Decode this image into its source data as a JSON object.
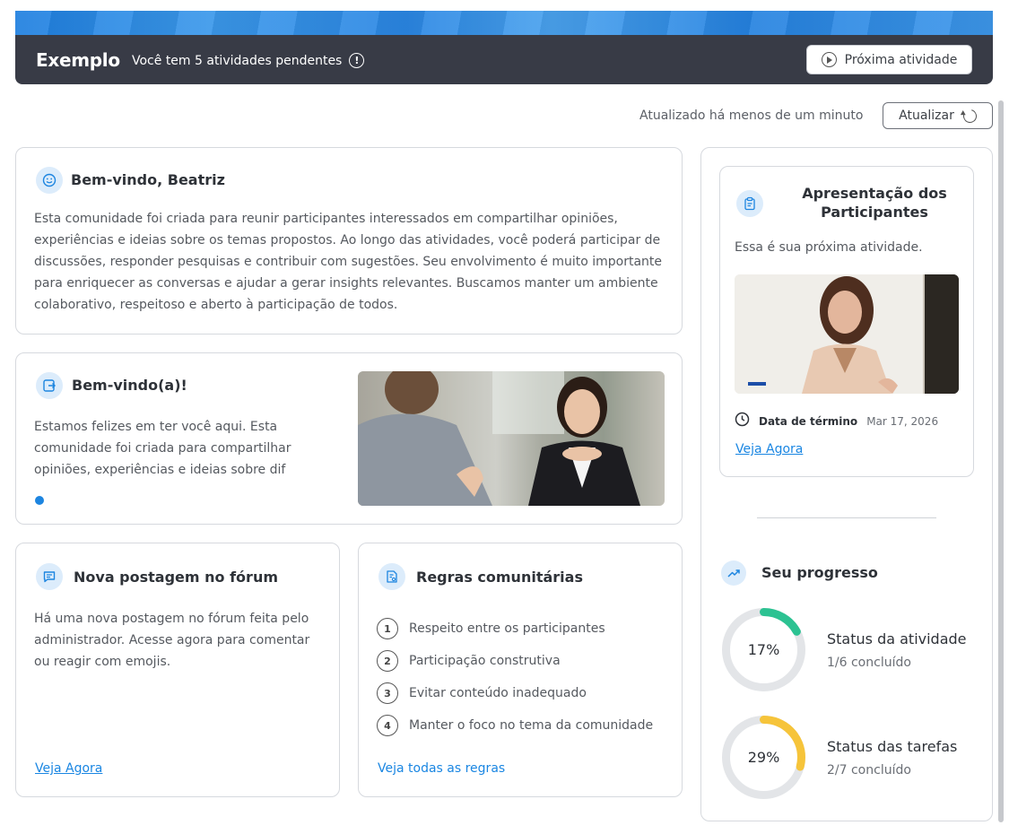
{
  "header": {
    "brand": "Exemplo",
    "pending_text": "Você tem 5 atividades pendentes",
    "next_button": "Próxima atividade"
  },
  "update": {
    "status": "Atualizado há menos de um minuto",
    "button": "Atualizar"
  },
  "welcome": {
    "title": "Bem-vindo, Beatriz",
    "text": "Esta comunidade foi criada para reunir participantes interessados em compartilhar opiniões, experiências e ideias sobre os temas propostos. Ao longo das atividades, você poderá participar de discussões, responder pesquisas e contribuir com sugestões. Seu envolvimento é muito importante para enriquecer as conversas e ajudar a gerar insights relevantes. Buscamos manter um ambiente colaborativo, respeitoso e aberto à participação de todos."
  },
  "carousel": {
    "title": "Bem-vindo(a)!",
    "text": "Estamos felizes em ter você aqui. Esta comunidade foi criada para compartilhar opiniões, experiências e ideias sobre dif"
  },
  "forum": {
    "title": "Nova postagem no fórum",
    "text": "Há uma nova postagem no fórum feita pelo administrador. Acesse agora para comentar ou reagir com emojis.",
    "link": "Veja Agora"
  },
  "rules": {
    "title": "Regras comunitárias",
    "items": [
      {
        "num": "1",
        "label": "Respeito entre os participantes"
      },
      {
        "num": "2",
        "label": "Participação construtiva"
      },
      {
        "num": "3",
        "label": "Evitar conteúdo inadequado"
      },
      {
        "num": "4",
        "label": "Manter o foco no tema da comunidade"
      }
    ],
    "link": "Veja todas as regras"
  },
  "next_activity": {
    "title": "Apresentação dos Participantes",
    "subtitle": "Essa é sua próxima atividade.",
    "due_label": "Data de término",
    "due_date": "Mar 17, 2026",
    "link": "Veja Agora"
  },
  "progress": {
    "title": "Seu progresso",
    "items": [
      {
        "percent_label": "17%",
        "value": 0.17,
        "title": "Status da atividade",
        "sub": "1/6 concluído",
        "color": "#2cc292"
      },
      {
        "percent_label": "29%",
        "value": 0.29,
        "title": "Status das tarefas",
        "sub": "2/7 concluído",
        "color": "#f6c43a"
      }
    ]
  },
  "colors": {
    "accent": "#1d85e0",
    "header_bar": "#383b46",
    "ring_track": "#e3e5e8"
  }
}
